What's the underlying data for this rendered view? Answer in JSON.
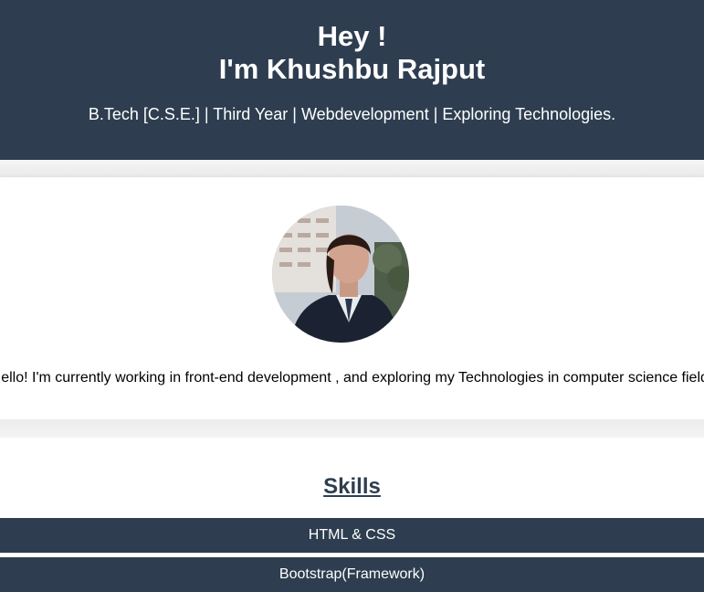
{
  "header": {
    "greeting": "Hey !",
    "name": "I'm Khushbu Rajput",
    "tagline": "B.Tech [C.S.E.] | Third Year | Webdevelopment | Exploring Technologies."
  },
  "about": {
    "text": "Hello! I'm currently working in front-end development , and exploring my Technologies in computer science field."
  },
  "skills": {
    "title": "Skills",
    "items": [
      "HTML & CSS",
      "Bootstrap(Framework)"
    ]
  },
  "colors": {
    "primary": "#2e3e50",
    "text_light": "#ffffff"
  }
}
